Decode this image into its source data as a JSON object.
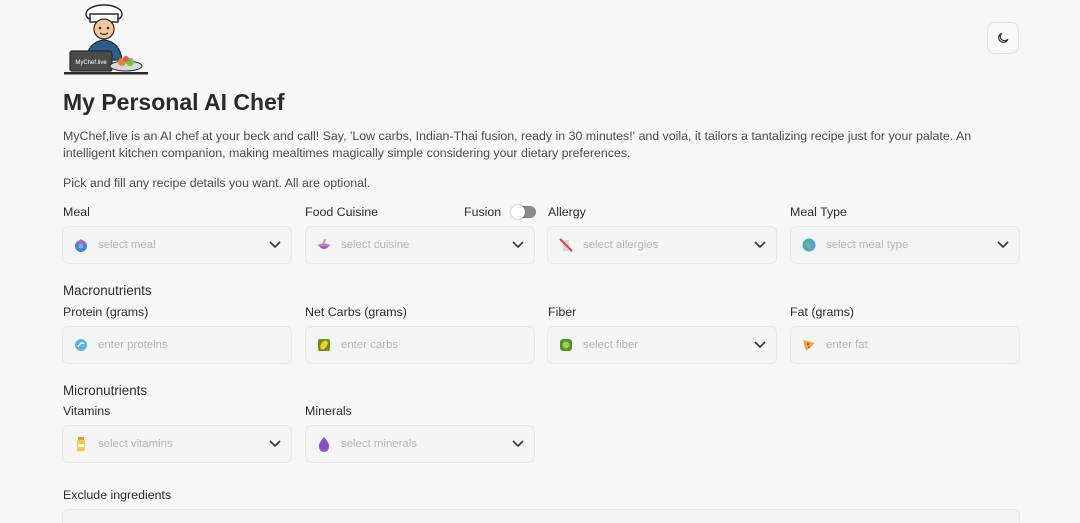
{
  "logo": {
    "text": "MyChef.live"
  },
  "header": {
    "title": "My Personal AI Chef",
    "intro": "MyChef,live is an AI chef at your beck and call! Say, 'Low carbs, Indian-Thai fusion, ready in 30 minutes!' and voila, it tailors a tantalizing recipe just for your palate. An intelligent kitchen companion, making mealtimes magically simple considering your dietary preferences.",
    "hint": "Pick and fill any recipe details you want. All are optional."
  },
  "theme_toggle": {
    "icon": "moon-icon"
  },
  "basics": {
    "meal": {
      "label": "Meal",
      "placeholder": "select meal",
      "icon": "meal-icon"
    },
    "cuisine": {
      "label": "Food Cuisine",
      "placeholder": "select cuisine",
      "icon": "bowl-icon"
    },
    "fusion": {
      "label": "Fusion",
      "enabled": false
    },
    "allergy": {
      "label": "Allergy",
      "placeholder": "select allergies",
      "icon": "allergy-icon"
    },
    "meal_type": {
      "label": "Meal Type",
      "placeholder": "select meal type",
      "icon": "globe-icon"
    }
  },
  "macros": {
    "title": "Macronutrients",
    "protein": {
      "label": "Protein (grams)",
      "placeholder": "enter proteins",
      "icon": "protein-icon"
    },
    "carbs": {
      "label": "Net Carbs (grams)",
      "placeholder": "enter carbs",
      "icon": "corn-icon"
    },
    "fiber": {
      "label": "Fiber",
      "placeholder": "select fiber",
      "icon": "fiber-icon"
    },
    "fat": {
      "label": "Fat (grams)",
      "placeholder": "enter fat",
      "icon": "pizza-icon"
    }
  },
  "micros": {
    "title": "Micronutrients",
    "vitamins": {
      "label": "Vitamins",
      "placeholder": "select vitamins",
      "icon": "vitamin-bottle-icon"
    },
    "minerals": {
      "label": "Minerals",
      "placeholder": "select minerals",
      "icon": "mineral-drop-icon"
    }
  },
  "exclude": {
    "label": "Exclude ingredients"
  },
  "colors": {
    "accent": "#2b2b2b",
    "placeholder": "#b4b4b4",
    "field_bg": "#f4f4f4"
  }
}
